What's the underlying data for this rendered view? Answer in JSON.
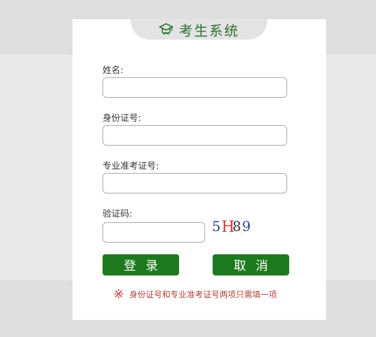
{
  "header": {
    "title": "考生系统",
    "icon": "graduation-cap-icon"
  },
  "form": {
    "name_label": "姓名:",
    "name_value": "",
    "id_label": "身份证号:",
    "id_value": "",
    "exam_label": "专业准考证号:",
    "exam_value": "",
    "captcha_label": "验证码:",
    "captcha_value": "",
    "captcha_chars": [
      "5",
      "H",
      "8",
      "9"
    ]
  },
  "buttons": {
    "login": "登录",
    "cancel": "取消"
  },
  "note": {
    "symbol": "※",
    "text": "身份证号和专业准考证号两项只需填一项"
  },
  "colors": {
    "accent": "#1e7a1e",
    "note": "#b0443c"
  }
}
